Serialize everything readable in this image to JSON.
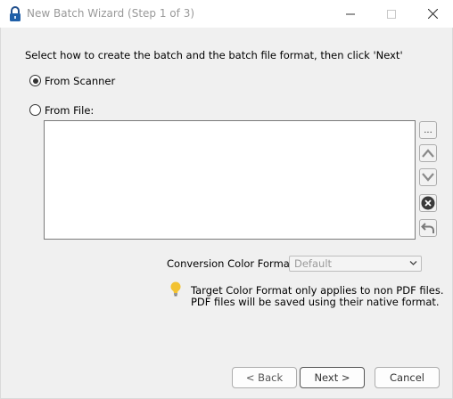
{
  "window": {
    "title": "New Batch Wizard (Step 1 of 3)"
  },
  "instructions": "Select how to create the batch and the batch file format, then click 'Next'",
  "source": {
    "scanner_label": "From Scanner",
    "file_label": "From File:",
    "selected": "scanner"
  },
  "file_buttons": {
    "browse_label": "..."
  },
  "conversion": {
    "label": "Conversion Color Format:",
    "value": "Default"
  },
  "note": {
    "line1": "Target Color Format only applies to non PDF files.",
    "line2": "PDF files will be saved using their native format."
  },
  "buttons": {
    "back": "< Back",
    "next": "Next >",
    "cancel": "Cancel"
  }
}
